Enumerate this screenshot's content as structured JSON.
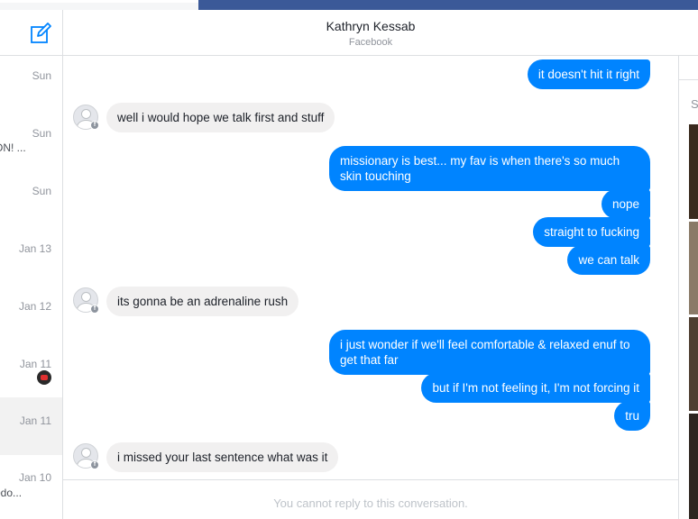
{
  "header": {
    "name": "Kathryn Kessab",
    "source": "Facebook"
  },
  "sidebar": {
    "threads": [
      {
        "date": "Sun",
        "snippet": ""
      },
      {
        "date": "Sun",
        "snippet": "ON! ..."
      },
      {
        "date": "Sun",
        "snippet": ""
      },
      {
        "date": "Jan 13",
        "snippet": ""
      },
      {
        "date": "Jan 12",
        "snippet": ""
      },
      {
        "date": "Jan 11",
        "snippet": ""
      },
      {
        "date": "Jan 11",
        "snippet": ""
      },
      {
        "date": "Jan 10",
        "snippet": "odo..."
      }
    ]
  },
  "messages": [
    {
      "text": "it doesn't hit it right"
    },
    {
      "text": "well i would hope we talk first and stuff"
    },
    {
      "text": "missionary is best... my fav is when there's so much skin touching"
    },
    {
      "text": "nope"
    },
    {
      "text": "straight to fucking"
    },
    {
      "text": "we can talk"
    },
    {
      "text": "its gonna be an adrenaline rush"
    },
    {
      "text": "i just wonder if we'll feel comfortable & relaxed enuf to get that far"
    },
    {
      "text": "but if I'm not feeling it, I'm not forcing it"
    },
    {
      "text": "tru"
    },
    {
      "text": "i missed your last sentence what was it"
    }
  ],
  "reply": {
    "disabled_text": "You cannot reply to this conversation."
  },
  "right_panel": {
    "heading_fragment": "S"
  },
  "colors": {
    "outgoing": "#0084ff",
    "incoming": "#f1f0f0",
    "topbar": "#3b5998"
  }
}
